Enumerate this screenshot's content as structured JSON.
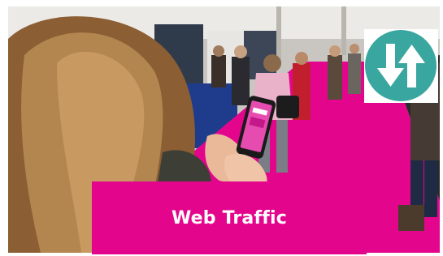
{
  "photo": {
    "subject": "person-using-phone",
    "colors": {
      "carpet": "#e3068d",
      "hair": "#9a6d3f",
      "phone_screen": "#e64bb0"
    }
  },
  "badge": {
    "icon": "up-down-arrows-icon",
    "colors": {
      "circle": "#3aa6a0",
      "arrows": "#ffffff"
    }
  },
  "banner": {
    "title": "Web Traffic",
    "color": "#e3068d"
  }
}
